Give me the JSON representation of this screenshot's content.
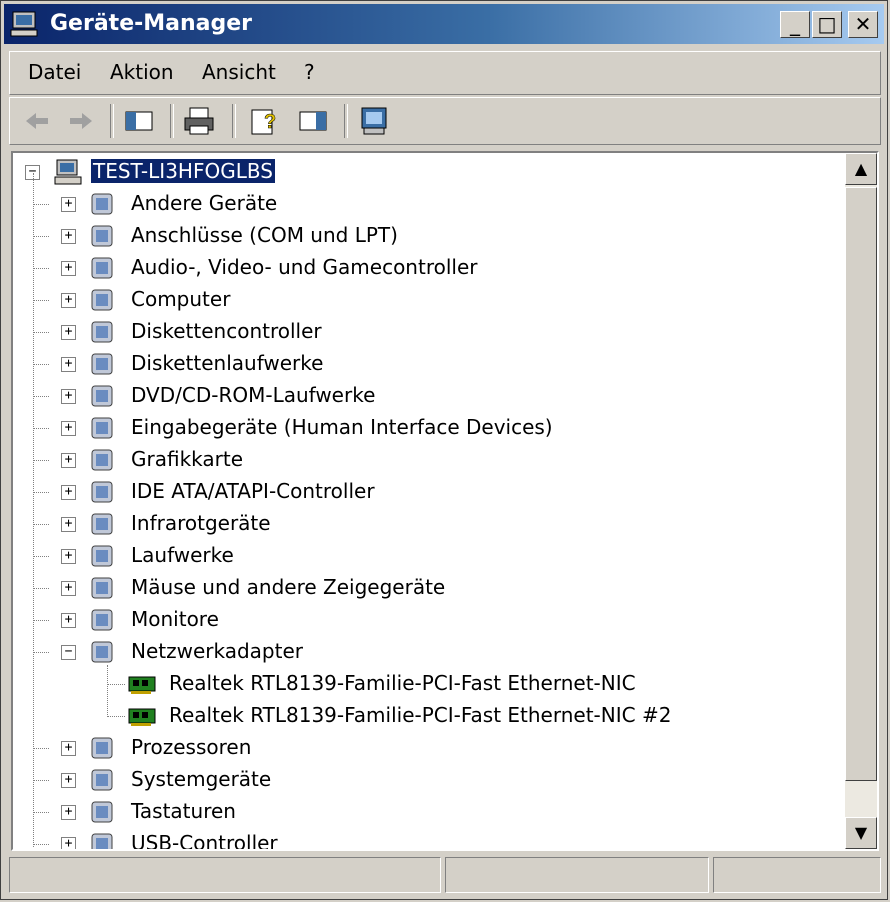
{
  "window": {
    "title": "Geräte-Manager"
  },
  "title_buttons": {
    "minimize": "_",
    "maximize": "□",
    "close": "✕"
  },
  "menu": {
    "file": "Datei",
    "action": "Aktion",
    "view": "Ansicht",
    "help": "?"
  },
  "toolbar": [
    "back-icon",
    "forward-icon",
    "show-hide-console-tree-icon",
    "print-icon",
    "properties-help-icon",
    "show-hide-action-pane-icon",
    "scan-hardware-icon"
  ],
  "tree": {
    "root": "TEST-LI3HFOGLBS",
    "categories": [
      "Andere Geräte",
      "Anschlüsse (COM und LPT)",
      "Audio-, Video- und Gamecontroller",
      "Computer",
      "Diskettencontroller",
      "Diskettenlaufwerke",
      "DVD/CD-ROM-Laufwerke",
      "Eingabegeräte (Human Interface Devices)",
      "Grafikkarte",
      "IDE ATA/ATAPI-Controller",
      "Infrarotgeräte",
      "Laufwerke",
      "Mäuse und andere Zeigegeräte",
      "Monitore",
      "Netzwerkadapter",
      "Prozessoren",
      "Systemgeräte",
      "Tastaturen",
      "USB-Controller"
    ],
    "network_children": [
      "Realtek RTL8139-Familie-PCI-Fast Ethernet-NIC",
      "Realtek RTL8139-Familie-PCI-Fast Ethernet-NIC #2"
    ]
  },
  "colors": {
    "title_active": "#0a246a",
    "selection": "#0a246a",
    "face": "#d4d0c8"
  }
}
